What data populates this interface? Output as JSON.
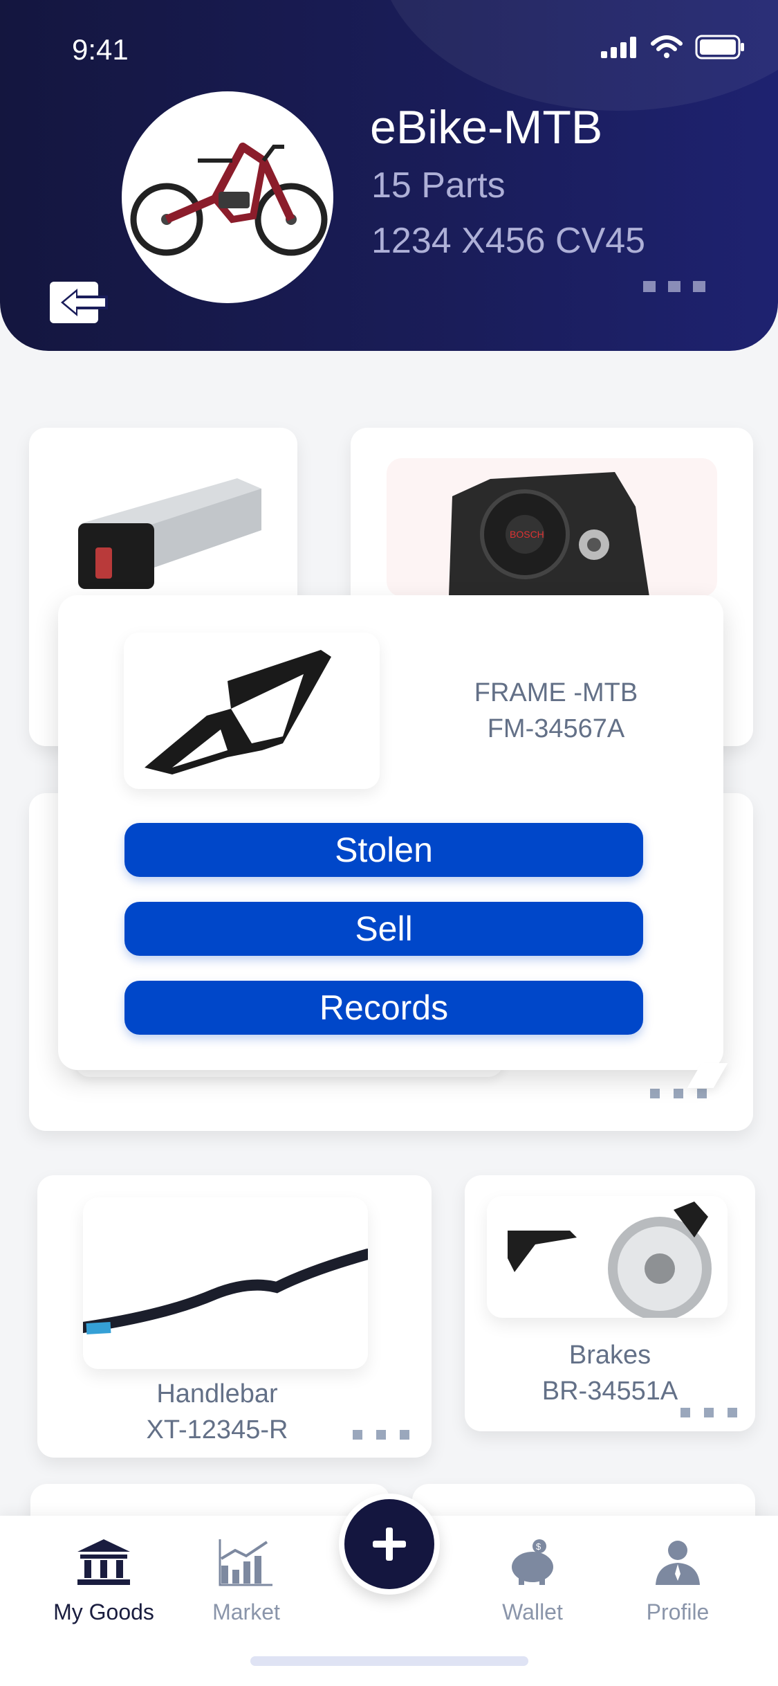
{
  "status_bar": {
    "time": "9:41"
  },
  "header": {
    "title": "eBike-MTB",
    "parts": "15 Parts",
    "code": "1234 X456 CV45"
  },
  "popup": {
    "name": "FRAME -MTB",
    "code": "FM-34567A",
    "buttons": [
      "Stolen",
      "Sell",
      "Records"
    ]
  },
  "parts": [
    {
      "name": "Handlebar",
      "code": "XT-12345-R"
    },
    {
      "name": "Brakes",
      "code": "BR-34551A"
    }
  ],
  "nav": {
    "items": [
      "My Goods",
      "Market",
      "Wallet",
      "Profile"
    ],
    "active": "My Goods"
  },
  "colors": {
    "header": "#14163f",
    "primary_button": "#0047c9",
    "text_secondary": "#637087"
  }
}
